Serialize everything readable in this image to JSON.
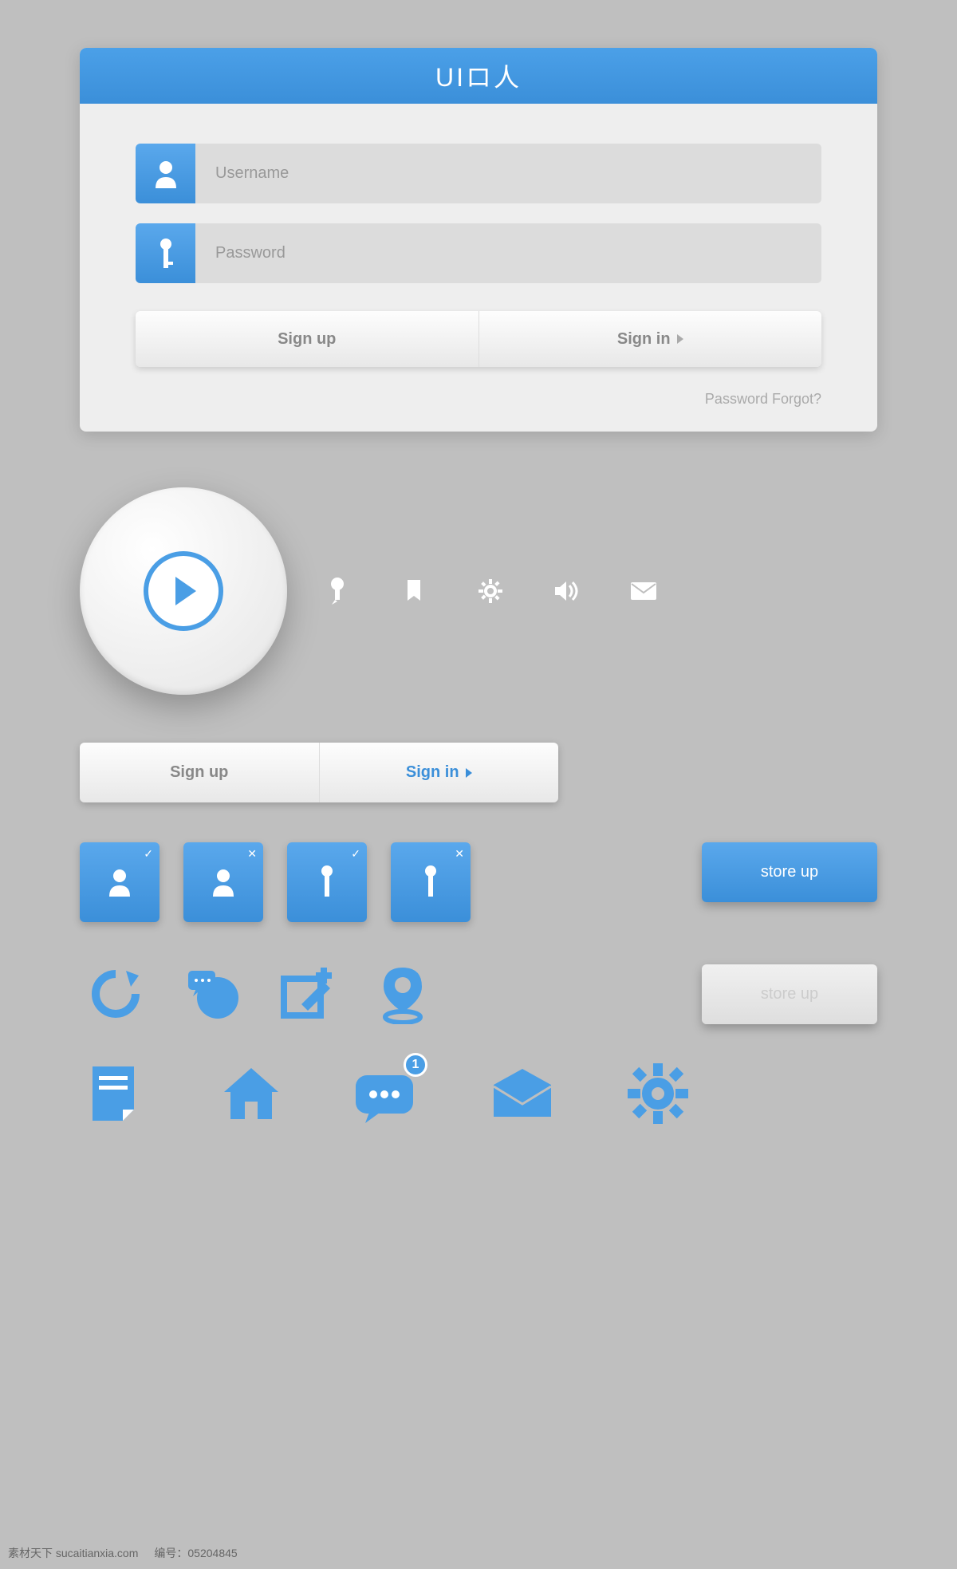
{
  "header": {
    "title": "UIロ人"
  },
  "login": {
    "username_placeholder": "Username",
    "password_placeholder": "Password",
    "sign_up": "Sign up",
    "sign_in": "Sign in",
    "forgot": "Password Forgot?"
  },
  "btns2": {
    "sign_up": "Sign up",
    "sign_in": "Sign in"
  },
  "store": {
    "blue": "store up",
    "gray": "store up"
  },
  "footer": {
    "left": "素材天下 sucaitianxia.com",
    "right": "编号：05204845"
  },
  "colors": {
    "primary": "#4a9ee5",
    "primary_dark": "#3b8fd9"
  }
}
